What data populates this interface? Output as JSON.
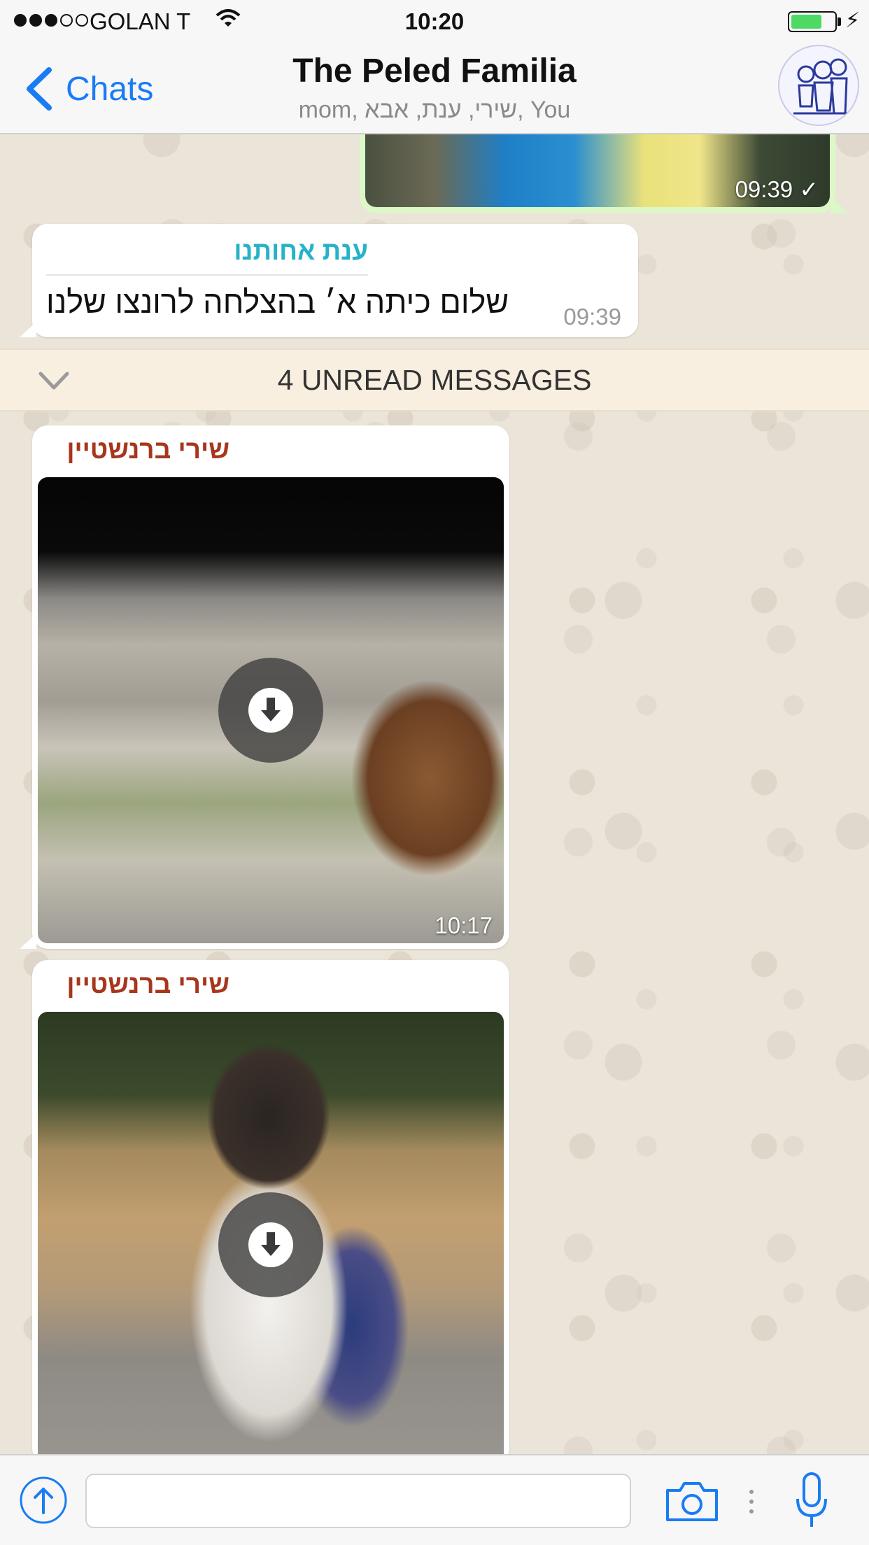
{
  "status_bar": {
    "carrier": "GOLAN T",
    "time": "10:20",
    "battery_level": 0.72
  },
  "nav": {
    "back_label": "Chats",
    "title": "The Peled Familia",
    "members": "mom, שירי, ענת, אבא, You"
  },
  "messages": {
    "outgoing_photo": {
      "time": "09:39",
      "status": "✓"
    },
    "text_message": {
      "sender": "ענת אחותנו",
      "text": "שלום כיתה א׳ בהצלחה לרונצו שלנו",
      "time": "09:39"
    },
    "unread_banner": "4 UNREAD MESSAGES",
    "image_message_1": {
      "sender": "שירי ברנשטיין",
      "time": "10:17"
    },
    "image_message_2": {
      "sender": "שירי ברנשטיין"
    }
  },
  "input_bar": {
    "placeholder": "",
    "icons": [
      "share-icon",
      "camera-icon",
      "microphone-icon"
    ]
  },
  "colors": {
    "accent": "#1a7cf5",
    "outgoing_bubble": "#dcf8c6",
    "sender_teal": "#27b2c9",
    "sender_red": "#a7361c",
    "unread_banner_bg": "#f8efe1"
  }
}
